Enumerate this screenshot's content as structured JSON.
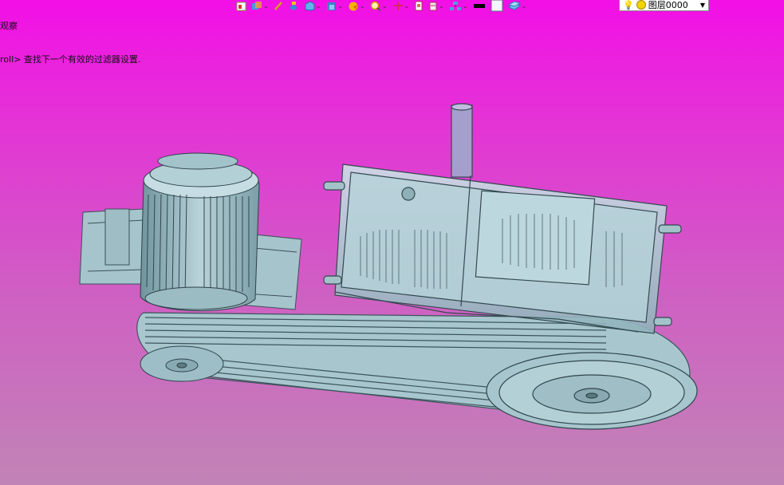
{
  "command_line": {
    "line1": "观察",
    "line2": "roll> 查找下一个有效的过滤器设置."
  },
  "toolbar": {
    "icons": [
      "layout-icon",
      "view-cube-icon",
      "pencil-icon",
      "paint-icon",
      "box-icon",
      "solid-icon",
      "render-icon",
      "zoom-icon",
      "move-icon",
      "document-icon",
      "layers-icon",
      "network-icon",
      "line-color-icon",
      "fill-color-icon",
      "material-icon"
    ]
  },
  "layer_selector": {
    "value": "图层0000"
  },
  "colors": {
    "background_top": "#f20fe6",
    "background_bottom": "#c184b6",
    "model": "#a9c9d1",
    "model_dark": "#5f7f88"
  }
}
